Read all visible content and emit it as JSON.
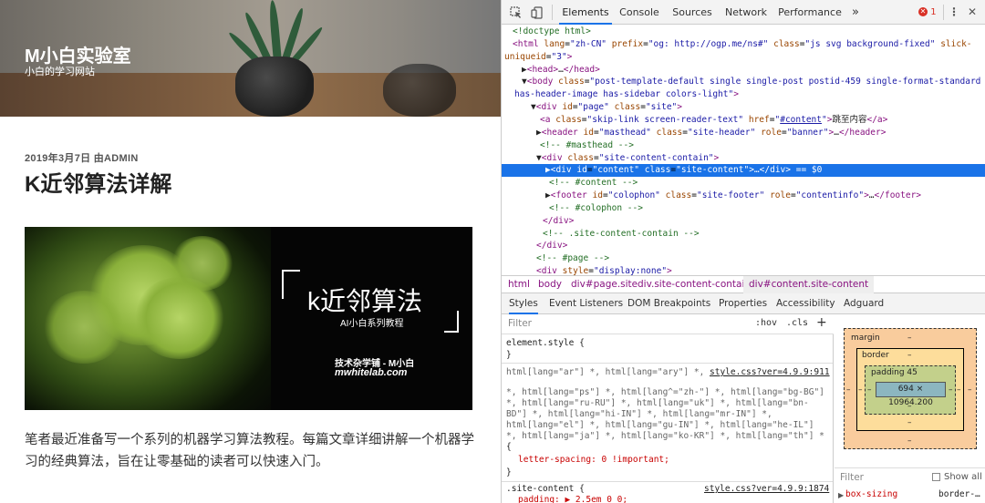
{
  "site": {
    "title": "M小白实验室",
    "description": "小白的学习网站"
  },
  "post": {
    "meta": "2019年3月7日 由ADMIN",
    "title": "K近邻算法详解",
    "paragraph": "笔者最近准备写一个系列的机器学习算法教程。每篇文章详细讲解一个机器学习的经典算法，旨在让零基础的读者可以快速入门。",
    "featured": {
      "title": "k近邻算法",
      "subtitle": "AI小白系列教程",
      "line1": "技术杂学铺 - M小白",
      "line2": "mwhitelab.com"
    }
  },
  "devtools": {
    "tabs": [
      "Elements",
      "Console",
      "Sources",
      "Network",
      "Performance"
    ],
    "more": "»",
    "error_count": "1",
    "dom_lines": [
      {
        "indent": 0,
        "html": "<span class='cm'>&lt;!doctype html&gt;</span>"
      },
      {
        "indent": 0,
        "html": "<span class='tag'>&lt;html</span> <span class='at'>lang</span>=<span class='av'>\"zh-CN\"</span> <span class='at'>prefix</span>=<span class='av'>\"og: http://ogp.me/ns#\"</span> <span class='at'>class</span>=<span class='av'>\"js svg background-fixed\"</span> <span class='at'>slick-</span>"
      },
      {
        "indent": -1,
        "html": "<span class='at'>uniqueid</span>=<span class='av'>\"3\"</span><span class='tag'>&gt;</span>"
      },
      {
        "indent": 1,
        "html": "<span class='tx'>▶</span><span class='tag'>&lt;head&gt;</span><span class='tx'>…</span><span class='tag'>&lt;/head&gt;</span>"
      },
      {
        "indent": 1,
        "html": "<span class='tx'>▼</span><span class='tag'>&lt;body</span> <span class='at'>class</span>=<span class='av'>\"post-template-default single single-post postid-459 single-format-standard</span>"
      },
      {
        "indent": 0.2,
        "html": "<span class='av'>has-header-image has-sidebar colors-light\"</span><span class='tag'>&gt;</span>"
      },
      {
        "indent": 2,
        "html": "<span class='tx'>▼</span><span class='tag'>&lt;div</span> <span class='at'>id</span>=<span class='av'>\"page\"</span> <span class='at'>class</span>=<span class='av'>\"site\"</span><span class='tag'>&gt;</span>"
      },
      {
        "indent": 3,
        "html": "<span class='tag'>&lt;a</span> <span class='at'>class</span>=<span class='av'>\"skip-link screen-reader-text\"</span> <span class='at'>href</span>=<span class='av'>\"<u>#content</u>\"</span><span class='tag'>&gt;</span><span class='tx'>跳至内容</span><span class='tag'>&lt;/a&gt;</span>"
      },
      {
        "indent": 2.6,
        "html": "<span class='tx'>▶</span><span class='tag'>&lt;header</span> <span class='at'>id</span>=<span class='av'>\"masthead\"</span> <span class='at'>class</span>=<span class='av'>\"site-header\"</span> <span class='at'>role</span>=<span class='av'>\"banner\"</span><span class='tag'>&gt;</span><span class='tx'>…</span><span class='tag'>&lt;/header&gt;</span>"
      },
      {
        "indent": 3,
        "html": "<span class='cm'>&lt;!-- #masthead --&gt;</span>"
      },
      {
        "indent": 2.6,
        "html": "<span class='tx'>▼</span><span class='tag'>&lt;div</span> <span class='at'>class</span>=<span class='av'>\"site-content-contain\"</span><span class='tag'>&gt;</span>"
      },
      {
        "indent": 3.6,
        "sel": true,
        "html": "<span class='tx'>▶</span><span class='tag'>&lt;div</span> <span class='at'>id</span>=<span class='av'>\"content\"</span> <span class='at'>class</span>=<span class='av'>\"site-content\"</span><span class='tag'>&gt;</span><span class='tx'>…</span><span class='tag'>&lt;/div&gt;</span> <span class='tx'>== $0</span>"
      },
      {
        "indent": 4,
        "html": "<span class='cm'>&lt;!-- #content --&gt;</span>"
      },
      {
        "indent": 3.6,
        "html": "<span class='tx'>▶</span><span class='tag'>&lt;footer</span> <span class='at'>id</span>=<span class='av'>\"colophon\"</span> <span class='at'>class</span>=<span class='av'>\"site-footer\"</span> <span class='at'>role</span>=<span class='av'>\"contentinfo\"</span><span class='tag'>&gt;</span><span class='tx'>…</span><span class='tag'>&lt;/footer&gt;</span>"
      },
      {
        "indent": 4,
        "html": "<span class='cm'>&lt;!-- #colophon --&gt;</span>"
      },
      {
        "indent": 3.3,
        "html": "<span class='tag'>&lt;/div&gt;</span>"
      },
      {
        "indent": 3.3,
        "html": "<span class='cm'>&lt;!-- .site-content-contain --&gt;</span>"
      },
      {
        "indent": 2.6,
        "html": "<span class='tag'>&lt;/div&gt;</span>"
      },
      {
        "indent": 2.6,
        "html": "<span class='cm'>&lt;!-- #page --&gt;</span>"
      },
      {
        "indent": 2.6,
        "html": "<span class='tag'>&lt;div</span> <span class='at'>style</span>=<span class='av'>\"display:none\"</span><span class='tag'>&gt;</span>"
      }
    ],
    "breadcrumbs": [
      "html",
      "body",
      "div#page.site",
      "div.site-content-contain",
      "div#content.site-content"
    ],
    "style_tabs": [
      "Styles",
      "Event Listeners",
      "DOM Breakpoints",
      "Properties",
      "Accessibility",
      "Adguard"
    ],
    "filter_placeholder": "Filter",
    "hov": ":hov",
    "cls": ".cls",
    "plus": "+",
    "style_lines": [
      "element.style {",
      "}",
      "html[lang=\"ar\"] *, html[lang=\"ary\"] *, html[lang=\"azb\"] *, html[lang=\"haz\"]",
      "*, html[lang=\"ps\"] *, html[lang^=\"zh-\"] *, html[lang=\"bg-BG\"]",
      "*, html[lang=\"ru-RU\"] *, html[lang=\"uk\"] *, html[lang=\"bn-",
      "BD\"] *, html[lang=\"hi-IN\"] *, html[lang=\"mr-IN\"] *,",
      "html[lang=\"el\"] *, html[lang=\"gu-IN\"] *, html[lang=\"he-IL\"]",
      "*, html[lang=\"ja\"] *, html[lang=\"ko-KR\"] *, html[lang=\"th\"] *",
      "{",
      "letter-spacing: 0 !important;",
      "}",
      ".site-content {",
      "padding: ▶ 2.5em 0 0;"
    ],
    "style_link1": "style.css?ver=4.9.9:911",
    "style_link2": "style.css?ver=4.9.9:1874",
    "boxmodel": {
      "margin": "margin",
      "border": "border",
      "padding": "padding 45",
      "content": "694 × 10964.200",
      "dash": "–"
    },
    "computed_filter": "Filter",
    "show_all": "Show all",
    "box_sizing": "box-sizing",
    "box_sizing_val": "border-…"
  },
  "colors": {
    "accent": "#1a73e8",
    "error": "#d93025"
  }
}
